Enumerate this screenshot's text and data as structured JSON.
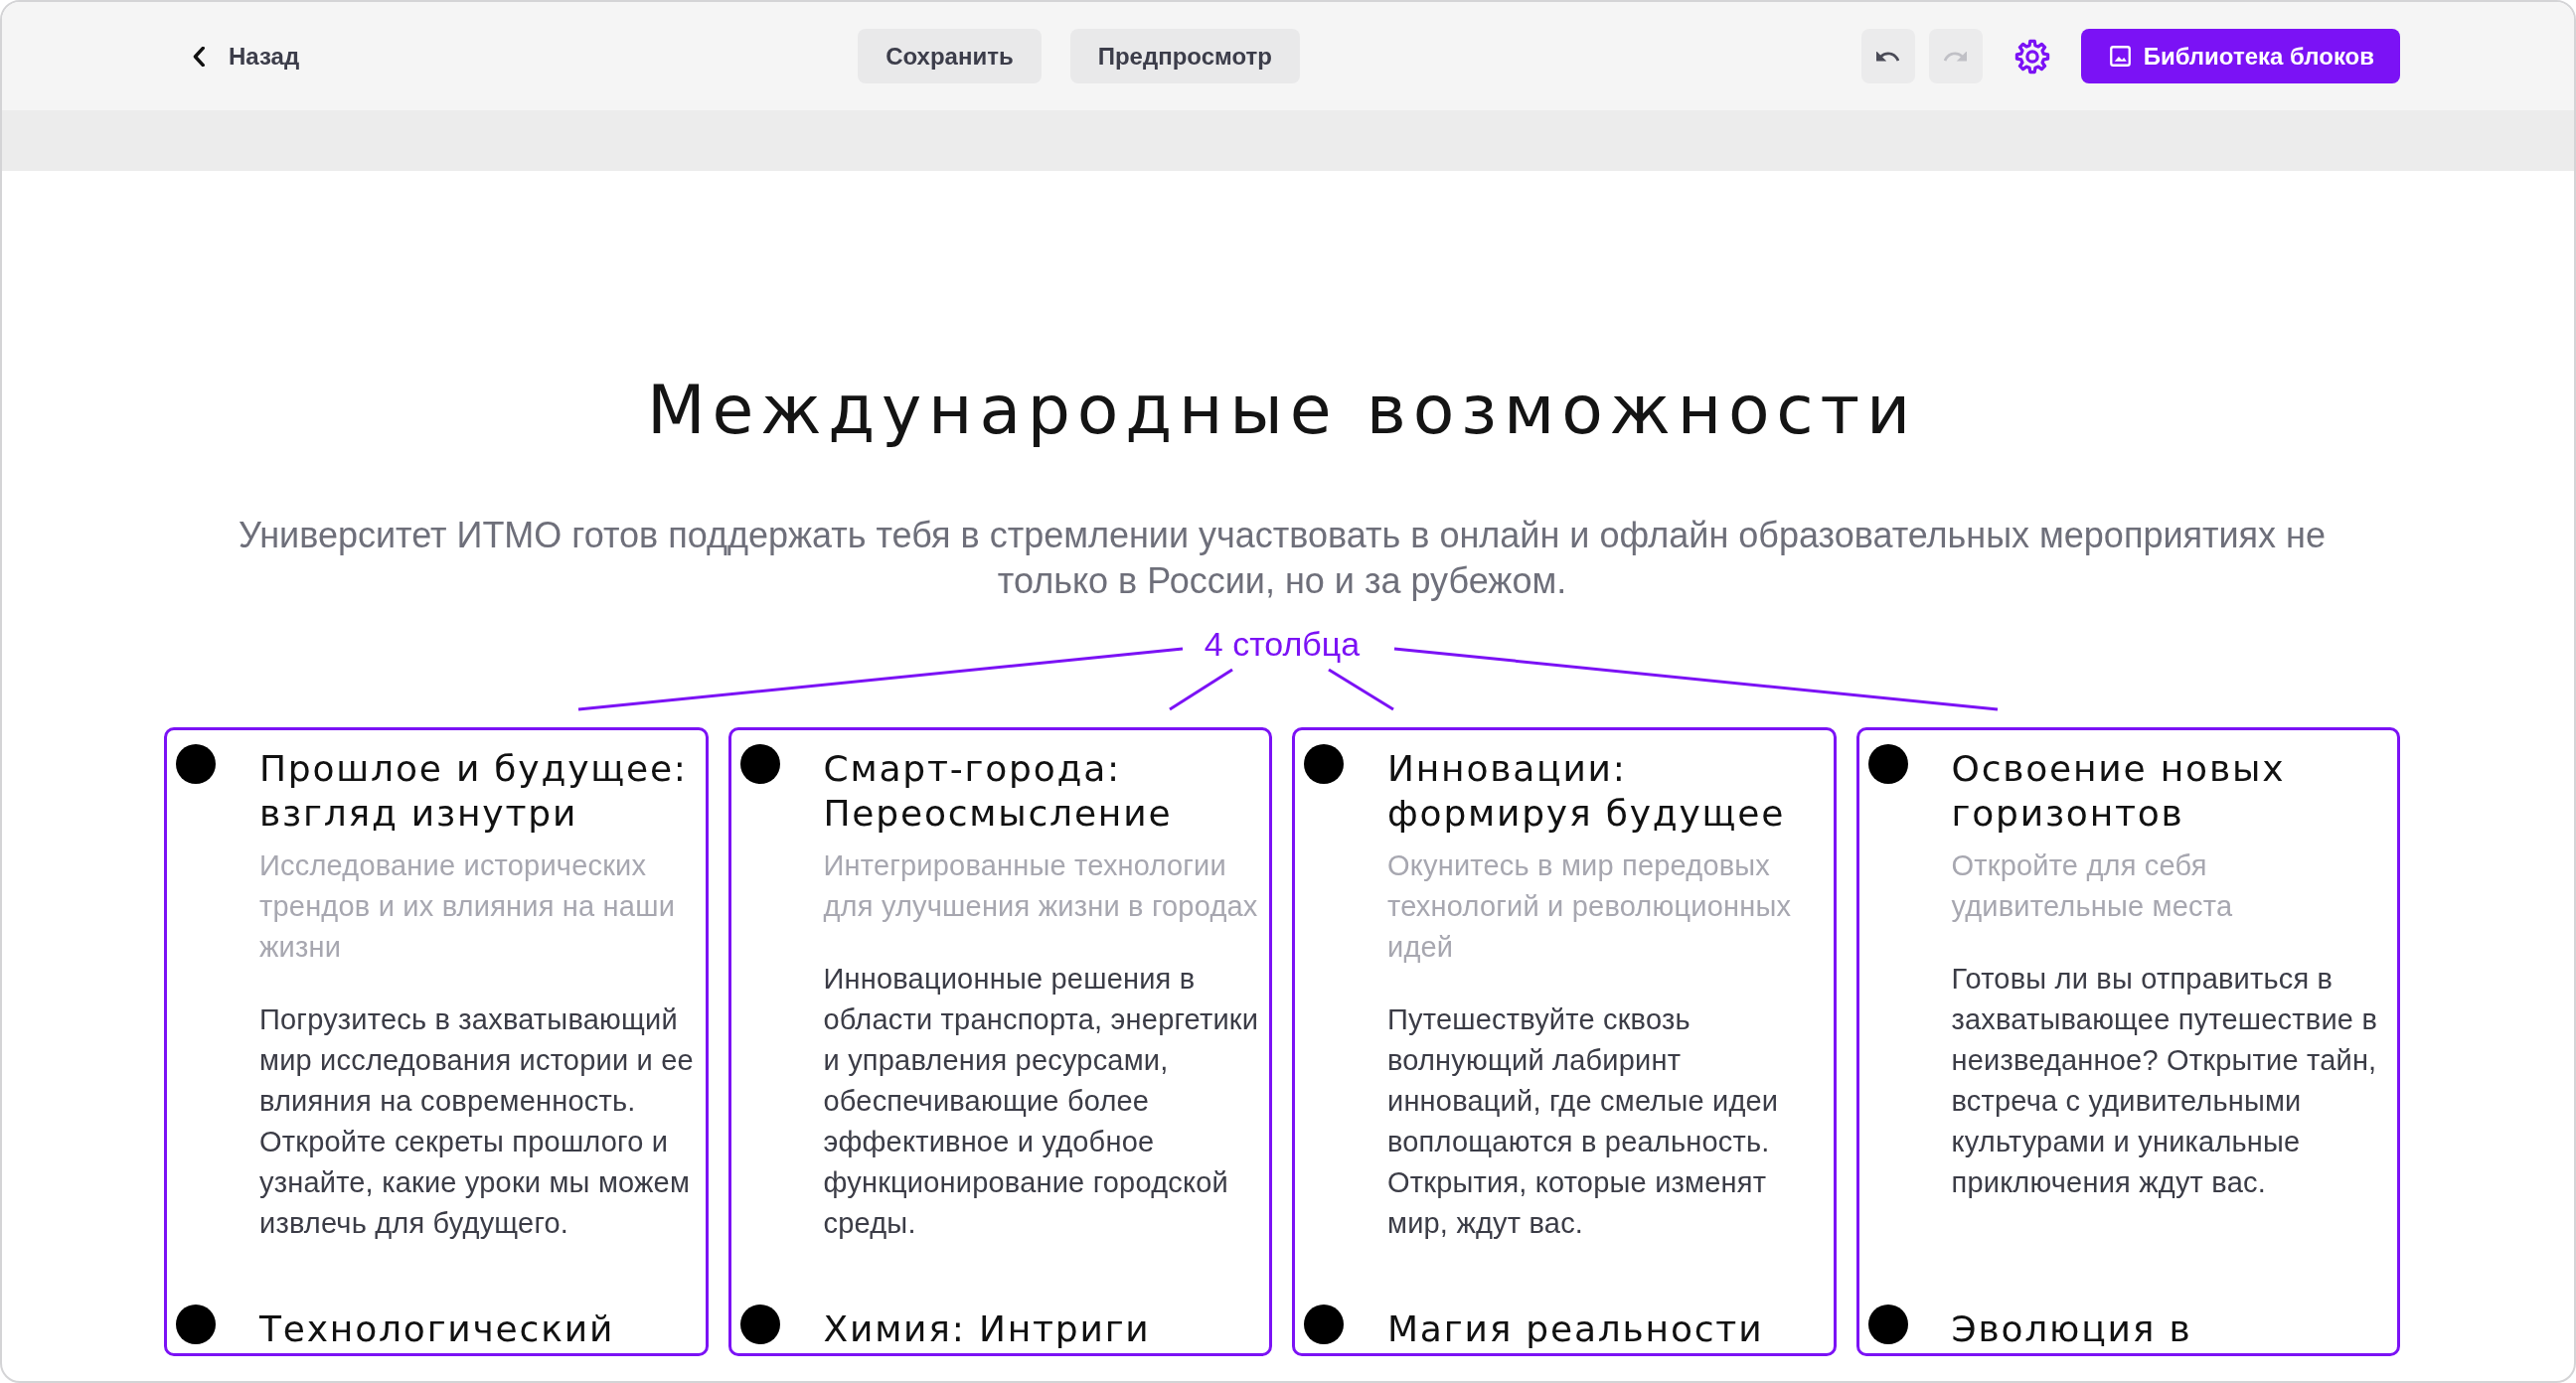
{
  "toolbar": {
    "back": {
      "label": "Назад"
    },
    "actions": [
      {
        "label": "Сохранить"
      },
      {
        "label": "Предпросмотр"
      }
    ],
    "history": [
      {
        "kind": "undo",
        "disabled": false
      },
      {
        "kind": "redo",
        "disabled": true
      }
    ],
    "library_button": {
      "label": "Библиотека блоков"
    }
  },
  "section": {
    "heading": "Международные возможности",
    "lead": "Университет ИТМО готов поддержать тебя в стремлении участвовать в онлайн и офлайн образовательных мероприятиях не только в России, но и за рубежом.",
    "annotation": {
      "label": "4 столбца"
    },
    "columns": [
      {
        "items": [
          {
            "title": "Прошлое и будущее: взгляд изнутри",
            "subtitle": "Исследование исторических трендов и их влияния на наши жизни",
            "text": "Погрузитесь в захватывающий мир исследования истории и ее влияния на современность. Откройте секреты прошлого и узнайте, какие уроки мы можем извлечь для будущего."
          },
          {
            "title": "Технологический"
          }
        ]
      },
      {
        "items": [
          {
            "title": "Смарт-города: Переосмысление",
            "subtitle": "Интегрированные технологии для улучшения жизни в городах",
            "text": "Инновационные решения в области транспорта, энергетики и управления ресурсами, обеспечивающие более эффективное и удобное функционирование городской среды."
          },
          {
            "title": "Химия: Интриги"
          }
        ]
      },
      {
        "items": [
          {
            "title": "Инновации: формируя будущее",
            "subtitle": "Окунитесь в мир передовых технологий и революционных идей",
            "text": "Путешествуйте сквозь волнующий лабиринт инноваций, где смелые идеи воплощаются в реальность. Открытия, которые изменят мир, ждут вас."
          },
          {
            "title": "Магия реальности"
          }
        ]
      },
      {
        "items": [
          {
            "title": "Освоение новых горизонтов",
            "subtitle": "Откройте для себя удивительные места",
            "text": "Готовы ли вы отправиться в захватывающее путешествие в неизведанное? Открытие тайн, встреча с удивительными культурами и уникальные приключения ждут вас."
          },
          {
            "title": "Эволюция в"
          }
        ]
      }
    ]
  }
}
